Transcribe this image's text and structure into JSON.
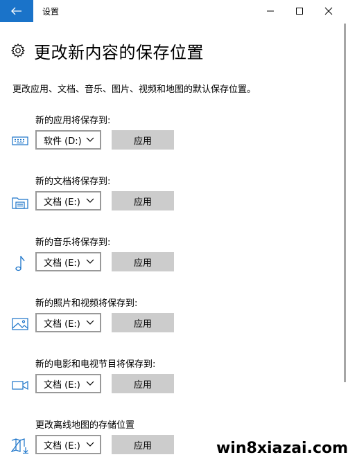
{
  "window": {
    "title": "设置"
  },
  "page": {
    "title": "更改新内容的保存位置",
    "description": "更改应用、文档、音乐、图片、视频和地图的默认保存位置。"
  },
  "sections": [
    {
      "label": "新的应用将保存到:",
      "drive": "软件 (D:)",
      "apply": "应用",
      "icon": "keyboard-icon"
    },
    {
      "label": "新的文档将保存到:",
      "drive": "文档 (E:)",
      "apply": "应用",
      "icon": "document-folder-icon"
    },
    {
      "label": "新的音乐将保存到:",
      "drive": "文档 (E:)",
      "apply": "应用",
      "icon": "music-note-icon"
    },
    {
      "label": "新的照片和视频将保存到:",
      "drive": "文档 (E:)",
      "apply": "应用",
      "icon": "picture-icon"
    },
    {
      "label": "新的电影和电视节目将保存到:",
      "drive": "文档 (E:)",
      "apply": "应用",
      "icon": "video-camera-icon"
    },
    {
      "label": "更改离线地图的存储位置",
      "drive": "文档 (E:)",
      "apply": "应用",
      "icon": "map-download-icon"
    }
  ],
  "watermark": "win8xiazai.com",
  "colors": {
    "accent": "#1a73c9",
    "button": "#cccccc",
    "select_border": "#999999"
  }
}
